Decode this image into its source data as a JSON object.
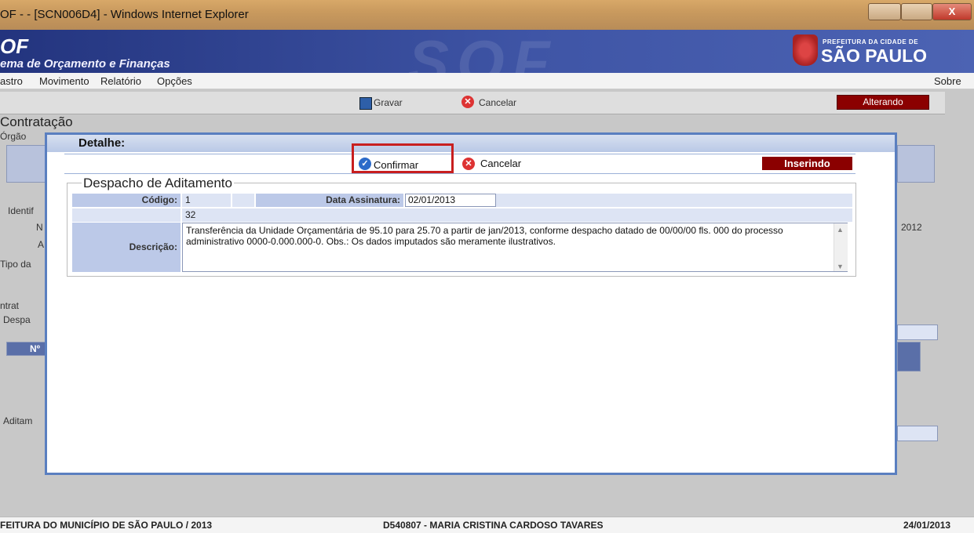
{
  "window": {
    "title": "OF - - [SCN006D4] - Windows Internet Explorer",
    "close_glyph": "X"
  },
  "banner": {
    "app_short": "OF",
    "app_name": "ema de Orçamento e Finanças",
    "watermark": "SOF",
    "logo_small": "PREFEITURA DA CIDADE DE",
    "logo_big": "SÃO PAULO"
  },
  "menu": {
    "items": [
      "astro",
      "Movimento",
      "Relatório",
      "Opções"
    ],
    "about": "Sobre"
  },
  "background": {
    "save_label": "Gravar",
    "cancel_label": "Cancelar",
    "status": "Alterando",
    "page_title": "Contratação",
    "orgao_label": "Órgão",
    "ident_label": "Identif",
    "n_label": "N",
    "a_label": "A",
    "tipo_label": "Tipo da",
    "year_value": "2012",
    "contrat_label": "ntrat",
    "despa_label": "Despa",
    "no_label": "Nº",
    "aditam_label": "Aditam"
  },
  "modal": {
    "title": "Detalhe:",
    "confirm_label": "Confirmar",
    "cancel_label": "Cancelar",
    "status": "Inserindo",
    "section_title": "Despacho de Aditamento",
    "codigo_label": "Código:",
    "codigo_value": "1",
    "data_label": "Data Assinatura:",
    "data_value": "02/01/2013",
    "char_count": "32",
    "descricao_label": "Descrição:",
    "descricao_value": "Transferência da Unidade Orçamentária de 95.10 para 25.70 a partir de jan/2013, conforme despacho datado de 00/00/00 fls. 000 do processo administrativo 0000-0.000.000-0. Obs.: Os dados imputados são meramente ilustrativos."
  },
  "footer": {
    "left": "FEITURA DO MUNICÍPIO DE SÃO PAULO / 2013",
    "user": "D540807 - MARIA CRISTINA CARDOSO TAVARES",
    "date": "24/01/2013"
  },
  "colors": {
    "banner": "#3f55a6",
    "status_badge": "#8b0000",
    "highlight": "#c81f1f",
    "modal_border": "#5a7fc0"
  }
}
